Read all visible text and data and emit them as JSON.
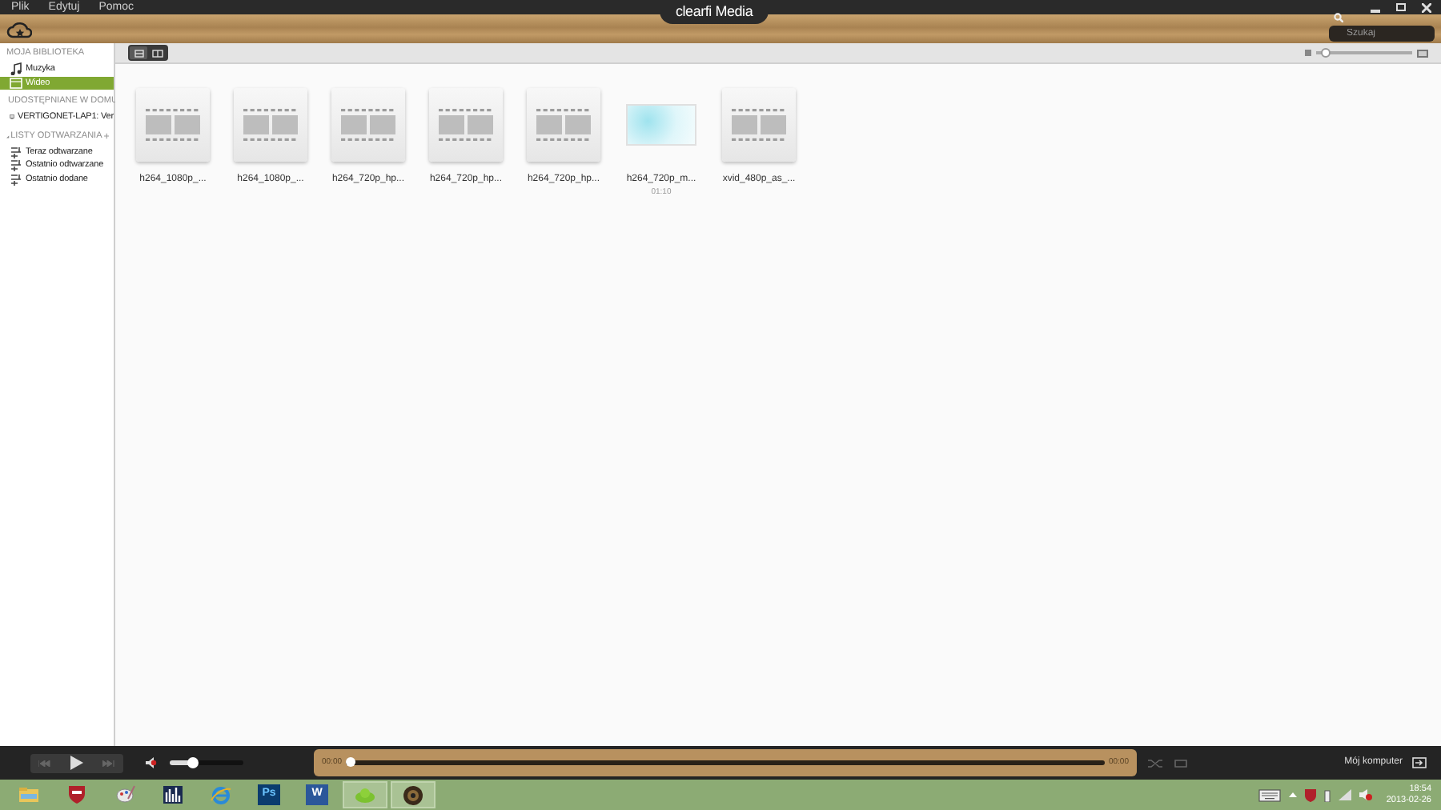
{
  "menu": [
    "Plik",
    "Edytuj",
    "Pomoc"
  ],
  "app_title": "clearfi Media",
  "search": {
    "placeholder": "Szukaj"
  },
  "sidebar": [
    {
      "title": "MOJA BIBLIOTEKA",
      "kind": "plain",
      "items": [
        {
          "label": "Muzyka",
          "kind": "music",
          "selected": false
        },
        {
          "label": "Wideo",
          "kind": "video",
          "selected": true
        }
      ]
    },
    {
      "title": "UDOSTĘPNIANE W DOMU",
      "kind": "collapsible",
      "items": [
        {
          "label": "VERTIGONET-LAP1: Ver",
          "kind": "computer",
          "selected": false
        }
      ]
    },
    {
      "title": "LISTY ODTWARZANIA",
      "kind": "collapsible_add",
      "items": [
        {
          "label": "Teraz odtwarzane",
          "kind": "playlist",
          "selected": false
        },
        {
          "label": "Ostatnio odtwarzane",
          "kind": "playlist",
          "selected": false
        },
        {
          "label": "Ostatnio dodane",
          "kind": "playlist",
          "selected": false
        }
      ]
    }
  ],
  "view_toggle": [
    {
      "kind": "grid",
      "selected": true
    },
    {
      "kind": "list",
      "selected": false
    }
  ],
  "zoom_slider": {
    "level": 0.05
  },
  "thumbnails": [
    {
      "kind": "video",
      "label": "h264_1080p_..."
    },
    {
      "kind": "video",
      "label": "h264_1080p_..."
    },
    {
      "kind": "video",
      "label": "h264_720p_hp..."
    },
    {
      "kind": "video",
      "label": "h264_720p_hp..."
    },
    {
      "kind": "video",
      "label": "h264_720p_hp..."
    },
    {
      "kind": "preview",
      "label": "h264_720p_m...",
      "duration": "01:10"
    },
    {
      "kind": "video",
      "label": "xvid_480p_as_..."
    }
  ],
  "player": {
    "volume": {
      "level": 0.3
    },
    "progress": {
      "level": 0.0
    },
    "elapsed": "00:00",
    "total": "00:00",
    "device": "Mój komputer"
  },
  "taskbar": {
    "apps": [
      {
        "kind": "folder",
        "selected": false
      },
      {
        "kind": "shield",
        "selected": false
      },
      {
        "kind": "paint",
        "selected": false
      },
      {
        "kind": "bars",
        "selected": false
      },
      {
        "kind": "browser",
        "selected": false
      },
      {
        "kind": "ps",
        "label": "Ps",
        "selected": false
      },
      {
        "kind": "word",
        "label": "W",
        "selected": false
      },
      {
        "kind": "cloud",
        "selected": true
      },
      {
        "kind": "speaker",
        "selected": true
      }
    ],
    "time": "18:54",
    "date": "2013-02-26"
  }
}
